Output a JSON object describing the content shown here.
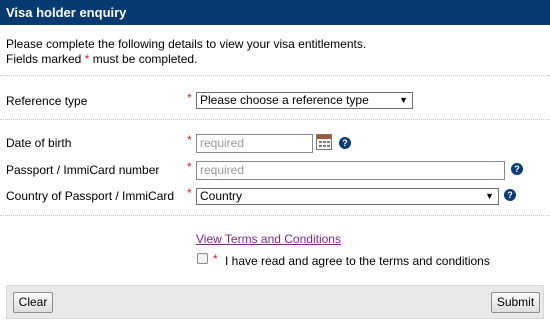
{
  "header": {
    "title": "Visa holder enquiry"
  },
  "intro": {
    "line1": "Please complete the following details to view your visa entitlements.",
    "line2_prefix": "Fields marked",
    "required_marker": "*",
    "line2_suffix": "must be completed."
  },
  "fields": {
    "reference_type": {
      "label": "Reference type",
      "value": "Please choose a reference type"
    },
    "dob": {
      "label": "Date of birth",
      "placeholder": "required"
    },
    "passport": {
      "label": "Passport / ImmiCard number",
      "placeholder": "required"
    },
    "country": {
      "label": "Country of Passport / ImmiCard",
      "value": "Country"
    }
  },
  "icons": {
    "dropdown_arrow": "▼",
    "help": "?",
    "calendar": "calendar-icon"
  },
  "terms": {
    "link": "View Terms and Conditions",
    "agree": "I have read and agree to the terms and conditions"
  },
  "buttons": {
    "clear": "Clear",
    "submit": "Submit"
  },
  "colors": {
    "header_bg": "#073a72",
    "required": "#d9232d",
    "link": "#7b2a86",
    "help_icon": "#0b3b75"
  }
}
